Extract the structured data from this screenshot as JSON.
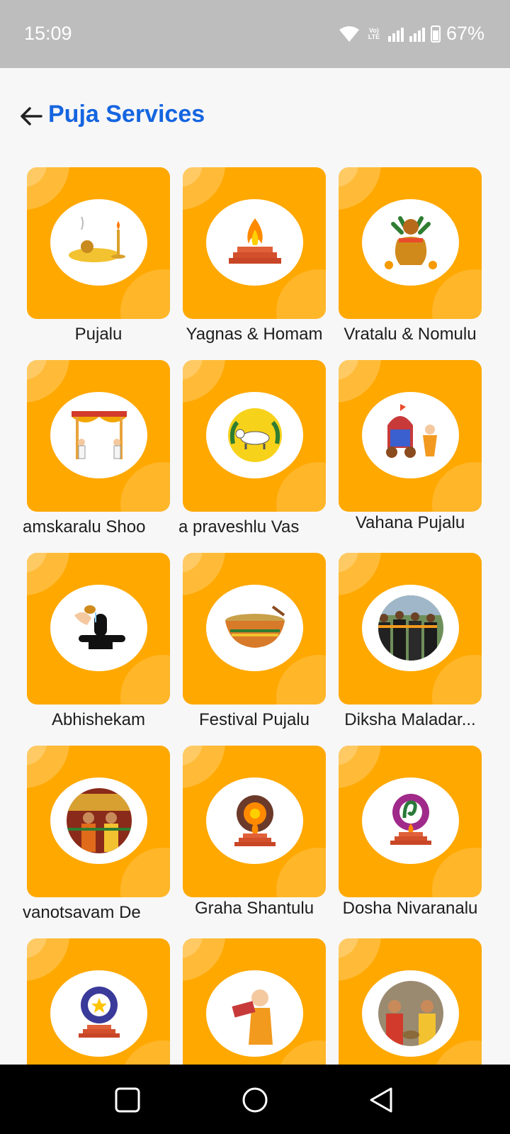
{
  "status_bar": {
    "time": "15:09",
    "battery": "67%",
    "volte": "Vo) LTE",
    "icons": [
      "wifi-icon",
      "volte-icon",
      "signal-icon",
      "signal-icon",
      "battery-icon"
    ]
  },
  "header": {
    "title": "Puja Services",
    "back_icon": "arrow-left-icon"
  },
  "colors": {
    "accent": "#1565e0",
    "tile": "#ffa800",
    "status_bar": "#bdbdbd",
    "nav_bar": "#000000",
    "background": "#f7f7f7"
  },
  "services": [
    {
      "label": "Pujalu",
      "icon": "puja-thali-icon"
    },
    {
      "label": "Yagnas & Homam",
      "icon": "homam-fire-icon"
    },
    {
      "label": "Vratalu & Nomulu",
      "icon": "kalasam-icon"
    },
    {
      "label": "amskaralu      Shoo",
      "icon": "pandal-icon"
    },
    {
      "label": "a praveshlu      Vas",
      "icon": "cow-icon"
    },
    {
      "label": "Vahana Pujalu",
      "icon": "chariot-icon"
    },
    {
      "label": "Abhishekam",
      "icon": "shivalingam-icon"
    },
    {
      "label": "Festival Pujalu",
      "icon": "pongal-pot-icon"
    },
    {
      "label": "Diksha Maladar...",
      "icon": "devotees-photo-icon"
    },
    {
      "label": "vanotsavam      De",
      "icon": "ceremony-photo-icon"
    },
    {
      "label": "Graha Shantulu",
      "icon": "navagraha-icon"
    },
    {
      "label": "Dosha Nivaranalu",
      "icon": "naga-icon"
    },
    {
      "label": "",
      "icon": "star-homam-icon"
    },
    {
      "label": "",
      "icon": "priest-scroll-icon"
    },
    {
      "label": "",
      "icon": "wedding-photo-icon"
    }
  ],
  "nav_bar": {
    "icons": [
      "recents-square-icon",
      "home-circle-icon",
      "back-triangle-icon"
    ]
  }
}
